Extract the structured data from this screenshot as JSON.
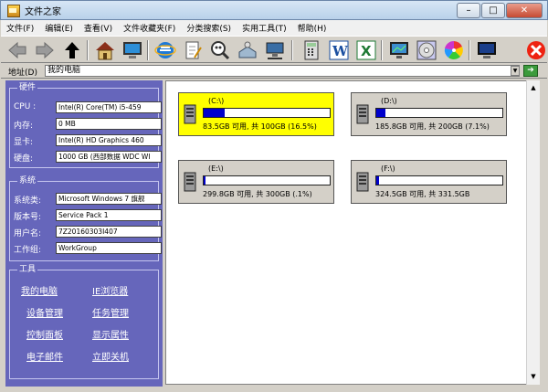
{
  "window": {
    "title": "文件之家"
  },
  "menu": [
    "文件(F)",
    "编辑(E)",
    "查看(V)",
    "文件收藏夹(F)",
    "分类搜索(S)",
    "实用工具(T)",
    "帮助(H)"
  ],
  "address": {
    "label": "地址(D)",
    "value": "我的电脑"
  },
  "hardware": {
    "title": "硬件",
    "rows": [
      {
        "label": "CPU :",
        "value": "Intel(R) Core(TM) i5-459"
      },
      {
        "label": "内存:",
        "value": "0 MB"
      },
      {
        "label": "显卡:",
        "value": "Intel(R) HD Graphics 460"
      },
      {
        "label": "硬盘:",
        "value": "1000 GB (西部数据 WDC WI"
      }
    ]
  },
  "system": {
    "title": "系统",
    "rows": [
      {
        "label": "系统类:",
        "value": "Microsoft Windows 7 旗舰"
      },
      {
        "label": "版本号:",
        "value": "Service Pack 1"
      },
      {
        "label": "用户名:",
        "value": "7Z20160303I407"
      },
      {
        "label": "工作组:",
        "value": "WorkGroup"
      }
    ]
  },
  "tools": {
    "title": "工具",
    "links": [
      "我的电脑",
      "IE浏览器",
      "设备管理",
      "任务管理",
      "控制面板",
      "显示属性",
      "电子邮件",
      "立即关机"
    ]
  },
  "drives": [
    {
      "letter": "(C:\\)",
      "info": "83.5GB 可用, 共 100GB (16.5%)",
      "used": 0.165,
      "selected": true
    },
    {
      "letter": "(D:\\)",
      "info": "185.8GB 可用, 共 200GB (7.1%)",
      "used": 0.071,
      "selected": false
    },
    {
      "letter": "(E:\\)",
      "info": "299.8GB 可用, 共 300GB (.1%)",
      "used": 0.001,
      "selected": false
    },
    {
      "letter": "(F:\\)",
      "info": "324.5GB 可用, 共 331.5GB",
      "used": 0.021,
      "selected": false
    }
  ],
  "colors": {
    "accent": "#6666bb",
    "selected_drive": "#ffff00",
    "drive_fill": "#0000cc"
  },
  "toolbar_icons": [
    "back-arrow-icon",
    "forward-arrow-icon",
    "up-arrow-icon",
    "home-icon",
    "computer-icon",
    "ie-icon",
    "notepad-icon",
    "search-magnifier-icon",
    "drive-icon",
    "network-icon",
    "calculator-icon",
    "word-icon",
    "excel-icon",
    "monitor-icon",
    "cd-icon",
    "color-wheel-icon",
    "display-icon",
    "exit-icon"
  ]
}
